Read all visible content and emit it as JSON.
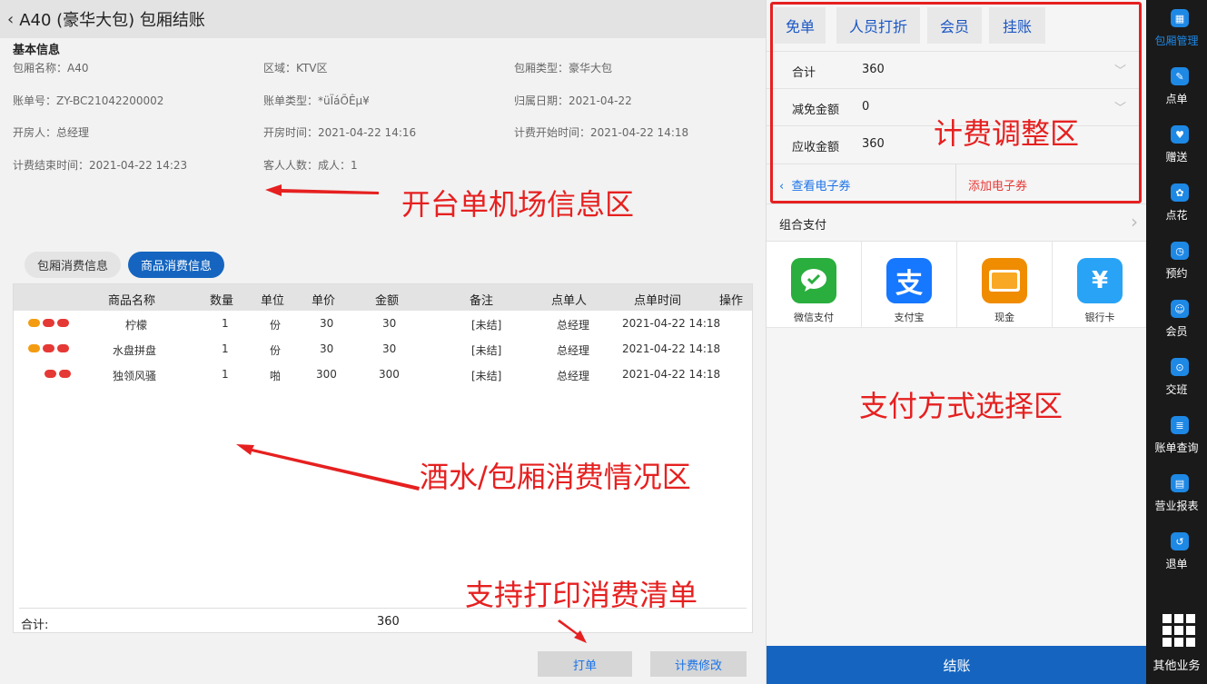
{
  "header": {
    "back": "‹",
    "title": "A40 (豪华大包) 包厢结账"
  },
  "basic_info": {
    "section_title": "基本信息",
    "fields": [
      "包厢名称：A40",
      "区域：KTV区",
      "包厢类型：豪华大包",
      "账单号：ZY-BC21042200002",
      "账单类型：*üÏáÕÊµ¥",
      "归属日期：2021-04-22",
      "开房人：总经理",
      "开房时间：2021-04-22 14:16",
      "计费开始时间：2021-04-22 14:18",
      "计费结束时间：2021-04-22 14:23",
      "客人人数：成人：1"
    ]
  },
  "tabs": [
    {
      "label": "包厢消费信息"
    },
    {
      "label": "商品消费信息"
    }
  ],
  "table": {
    "headers": [
      "商品名称",
      "数量",
      "单位",
      "单价",
      "金额",
      "备注",
      "点单人",
      "点单时间",
      "操作"
    ],
    "rows": [
      {
        "name": "柠檬",
        "qty": "1",
        "unit": "份",
        "price": "30",
        "amount": "30",
        "note": "[未结]",
        "orderer": "总经理",
        "time": "2021-04-22 14:18"
      },
      {
        "name": "水盘拼盘",
        "qty": "1",
        "unit": "份",
        "price": "30",
        "amount": "30",
        "note": "[未结]",
        "orderer": "总经理",
        "time": "2021-04-22 14:18"
      },
      {
        "name": "独领风骚",
        "qty": "1",
        "unit": "啪",
        "price": "300",
        "amount": "300",
        "note": "[未结]",
        "orderer": "总经理",
        "time": "2021-04-22 14:18"
      }
    ],
    "total_label": "合计:",
    "total_value": "360"
  },
  "bottom_buttons": {
    "print": "打单",
    "modify": "计费修改"
  },
  "fee_actions": [
    "免单",
    "人员打折",
    "会员",
    "挂账"
  ],
  "fee_rows": [
    {
      "label": "合计",
      "value": "360"
    },
    {
      "label": "减免金额",
      "value": "0"
    },
    {
      "label": "应收金额",
      "value": "360"
    }
  ],
  "coupon": {
    "view": "查看电子券",
    "add": "添加电子券"
  },
  "combo_pay": "组合支付",
  "payments": [
    {
      "label": "微信支付",
      "icon": "wechat-pay-icon",
      "color": "#2aae3e"
    },
    {
      "label": "支付宝",
      "icon": "alipay-icon",
      "color": "#1677ff"
    },
    {
      "label": "现金",
      "icon": "cash-icon",
      "color": "#f08c00"
    },
    {
      "label": "银行卡",
      "icon": "bank-card-icon",
      "color": "#29a3f5"
    }
  ],
  "checkout": "结账",
  "sidebar": [
    {
      "label": "包厢管理",
      "icon": "room-manage-icon"
    },
    {
      "label": "点单",
      "icon": "order-icon"
    },
    {
      "label": "赠送",
      "icon": "gift-icon"
    },
    {
      "label": "点花",
      "icon": "flower-icon"
    },
    {
      "label": "预约",
      "icon": "booking-icon"
    },
    {
      "label": "会员",
      "icon": "member-icon"
    },
    {
      "label": "交班",
      "icon": "shift-icon"
    },
    {
      "label": "账单查询",
      "icon": "bill-query-icon"
    },
    {
      "label": "营业报表",
      "icon": "report-icon"
    },
    {
      "label": "退单",
      "icon": "refund-icon"
    }
  ],
  "sidebar_more": "其他业务",
  "annotations": {
    "info_area": "开台单机场信息区",
    "fee_area": "计费调整区",
    "payment_area": "支付方式选择区",
    "consumption_area": "酒水/包厢消费情况区",
    "print_note": "支持打印消费清单"
  },
  "colors": {
    "accent": "#1565c0",
    "annotation": "#e62020",
    "sidebar_bg": "#1a1a1a"
  }
}
